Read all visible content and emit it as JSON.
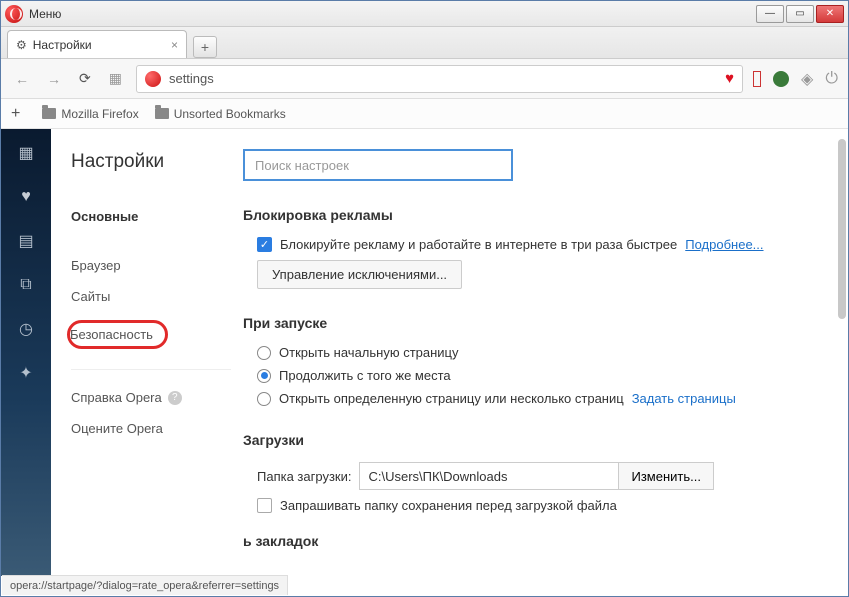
{
  "titlebar": {
    "menu": "Меню"
  },
  "tab": {
    "title": "Настройки"
  },
  "toolbar": {
    "url": "settings"
  },
  "bookmarks": {
    "folder1": "Mozilla Firefox",
    "folder2": "Unsorted Bookmarks"
  },
  "sidebar": {
    "title": "Настройки",
    "items": {
      "main": "Основные",
      "browser": "Браузер",
      "sites": "Сайты",
      "security": "Безопасность",
      "help": "Справка Opera",
      "rate": "Оцените Opera"
    }
  },
  "content": {
    "search_placeholder": "Поиск настроек",
    "adblock": {
      "title": "Блокировка рекламы",
      "check_label": "Блокируйте рекламу и работайте в интернете в три раза быстрее",
      "more": "Подробнее...",
      "manage_btn": "Управление исключениями..."
    },
    "startup": {
      "title": "При запуске",
      "opt1": "Открыть начальную страницу",
      "opt2": "Продолжить с того же места",
      "opt3": "Открыть определенную страницу или несколько страниц",
      "set_pages": "Задать страницы"
    },
    "downloads": {
      "title": "Загрузки",
      "folder_label": "Папка загрузки:",
      "folder_value": "C:\\Users\\ПК\\Downloads",
      "change_btn": "Изменить...",
      "ask_label": "Запрашивать папку сохранения перед загрузкой файла"
    },
    "bookmarks_panel": {
      "title_fragment": "ь закладок"
    }
  },
  "statusbar": {
    "url": "opera://startpage/?dialog=rate_opera&referrer=settings"
  }
}
